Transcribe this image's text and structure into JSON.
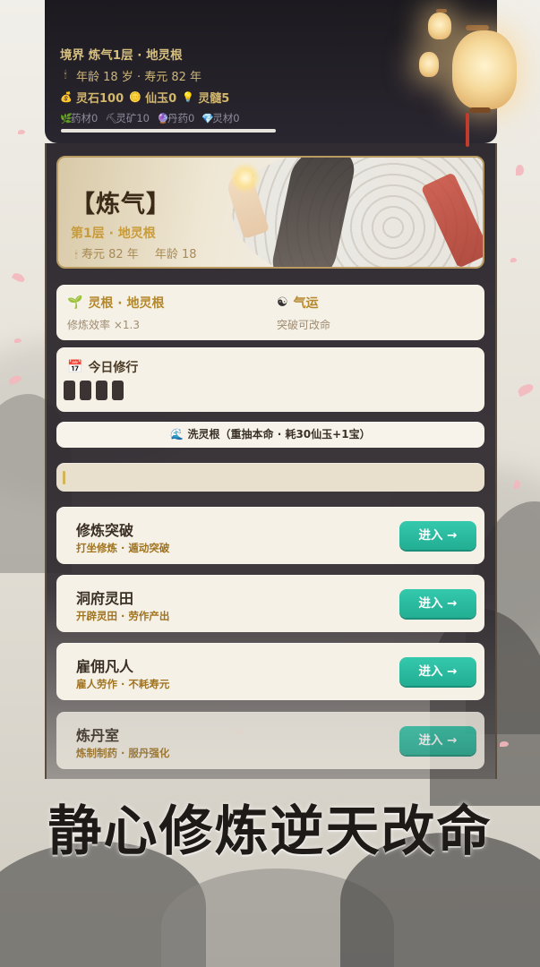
{
  "status": {
    "realm_line": "境界 炼气1层 · 地灵根",
    "age_line": "年龄 18 岁 · 寿元 82 年",
    "currency": [
      {
        "icon": "money-bag-icon",
        "label": "灵石100"
      },
      {
        "icon": "jade-coin-icon",
        "label": "仙玉0"
      },
      {
        "icon": "spirit-icon",
        "label": "灵髓5"
      }
    ],
    "materials": [
      {
        "icon": "herb-icon",
        "label": "药材0"
      },
      {
        "icon": "pickaxe-icon",
        "label": "灵矿10"
      },
      {
        "icon": "pill-icon",
        "label": "丹药0"
      },
      {
        "icon": "gem-icon",
        "label": "灵材0"
      }
    ],
    "age_icon": "candle-icon"
  },
  "hero": {
    "realm": "【炼气】",
    "stage": "第1层 · 地灵根",
    "lifespan": "寿元 82 年",
    "age": "年龄 18"
  },
  "root_card": {
    "root_title": "灵根 · 地灵根",
    "root_desc": "修炼效率 ×1.3",
    "luck_title": "气运",
    "luck_desc": "突破可改命"
  },
  "daily": {
    "title": "今日修行",
    "slots": 4
  },
  "wash_button": "洗灵根（重抽本命 · 耗30仙玉+1宝）",
  "entries": [
    {
      "name": "修炼突破",
      "desc": "打坐修炼 · 遁动突破",
      "button": "进入 →"
    },
    {
      "name": "洞府灵田",
      "desc": "开辟灵田 · 劳作产出",
      "button": "进入 →"
    },
    {
      "name": "雇佣凡人",
      "desc": "雇人劳作 · 不耗寿元",
      "button": "进入 →"
    },
    {
      "name": "炼丹室",
      "desc": "炼制制药 · 服丹强化",
      "button": "进入 →"
    }
  ],
  "slogan": "静心修炼逆天改命",
  "colors": {
    "accent_gold": "#c89b3b",
    "enter_button": "#22ae93",
    "panel_dark": "#1c1a1f",
    "card_bg": "#f6f1e6"
  }
}
